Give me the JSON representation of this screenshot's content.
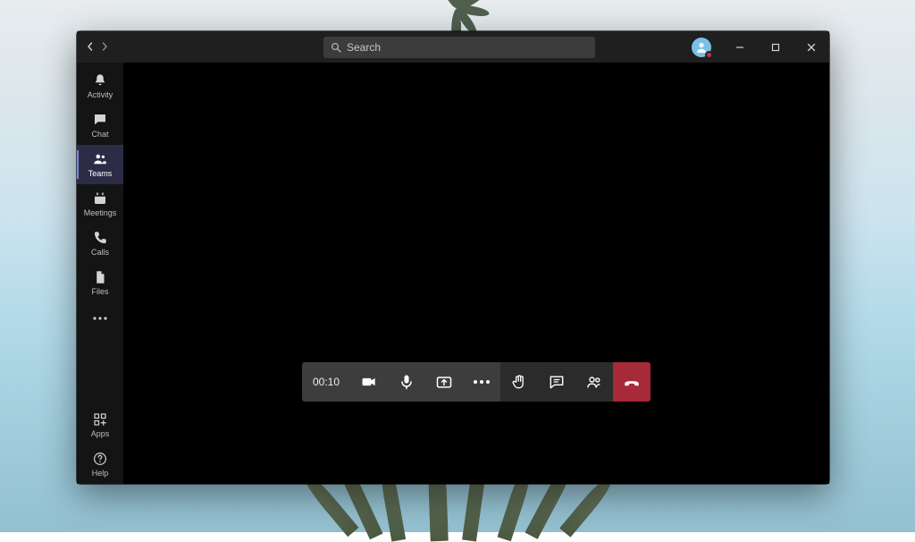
{
  "search": {
    "placeholder": "Search"
  },
  "sidebar": {
    "items": [
      {
        "label": "Activity"
      },
      {
        "label": "Chat"
      },
      {
        "label": "Teams"
      },
      {
        "label": "Meetings"
      },
      {
        "label": "Calls"
      },
      {
        "label": "Files"
      }
    ],
    "more_icon": "ellipsis",
    "bottom": [
      {
        "label": "Apps"
      },
      {
        "label": "Help"
      }
    ]
  },
  "meeting": {
    "duration": "00:10",
    "controls": {
      "camera": "on",
      "mic": "on",
      "share": "share-screen",
      "more": "more-actions",
      "raise_hand": "raise-hand",
      "chat": "chat",
      "participants": "participants",
      "hangup": "hang-up"
    }
  },
  "presence": {
    "status": "busy",
    "color": "#c4314b"
  },
  "colors": {
    "accent": "#7b83eb",
    "hangup": "#a72a3a",
    "sidebar_selected_bg": "#2d2c47"
  }
}
